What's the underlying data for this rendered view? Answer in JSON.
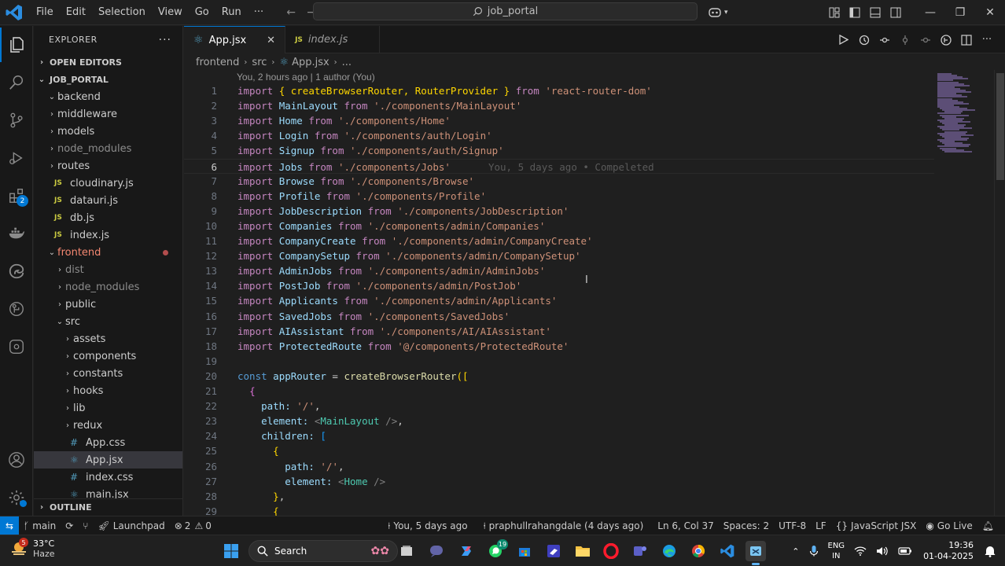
{
  "titlebar": {
    "menu": [
      "File",
      "Edit",
      "Selection",
      "View",
      "Go",
      "Run"
    ],
    "more": "···",
    "search_text": "job_portal"
  },
  "sidebar": {
    "title": "EXPLORER",
    "more": "···",
    "open_editors": "OPEN EDITORS",
    "root": "JOB_PORTAL",
    "backend": "backend",
    "backend_items": [
      {
        "label": "middleware",
        "kind": "folder"
      },
      {
        "label": "models",
        "kind": "folder"
      },
      {
        "label": "node_modules",
        "kind": "folder-dim"
      },
      {
        "label": "routes",
        "kind": "folder"
      },
      {
        "label": "cloudinary.js",
        "kind": "js"
      },
      {
        "label": "datauri.js",
        "kind": "js"
      },
      {
        "label": "db.js",
        "kind": "js"
      },
      {
        "label": "index.js",
        "kind": "js"
      }
    ],
    "frontend": "frontend",
    "frontend_items": [
      {
        "label": "dist",
        "kind": "folder-dim"
      },
      {
        "label": "node_modules",
        "kind": "folder-dim"
      },
      {
        "label": "public",
        "kind": "folder"
      }
    ],
    "src": "src",
    "src_items": [
      {
        "label": "assets",
        "kind": "folder"
      },
      {
        "label": "components",
        "kind": "folder"
      },
      {
        "label": "constants",
        "kind": "folder"
      },
      {
        "label": "hooks",
        "kind": "folder"
      },
      {
        "label": "lib",
        "kind": "folder"
      },
      {
        "label": "redux",
        "kind": "folder"
      },
      {
        "label": "App.css",
        "kind": "css"
      },
      {
        "label": "App.jsx",
        "kind": "jsx"
      },
      {
        "label": "index.css",
        "kind": "css"
      },
      {
        "label": "main.jsx",
        "kind": "jsx"
      }
    ],
    "outline": "OUTLINE",
    "activity_badge": "2"
  },
  "tabs": [
    {
      "label": "App.jsx",
      "active": true,
      "close": "✕"
    },
    {
      "label": "index.js",
      "active": false
    }
  ],
  "breadcrumb": [
    "frontend",
    "src",
    "App.jsx",
    "..."
  ],
  "editor": {
    "codelens": "You, 2 hours ago | 1 author (You)",
    "blame": "You, 5 days ago • Compeleted",
    "imports": [
      {
        "n": "1",
        "name": "{ createBrowserRouter, RouterProvider }",
        "path": "'react-router-dom'"
      },
      {
        "n": "2",
        "name": "MainLayout",
        "path": "'./components/MainLayout'"
      },
      {
        "n": "3",
        "name": "Home",
        "path": "'./components/Home'"
      },
      {
        "n": "4",
        "name": "Login",
        "path": "'./components/auth/Login'"
      },
      {
        "n": "5",
        "name": "Signup",
        "path": "'./components/auth/Signup'"
      },
      {
        "n": "6",
        "name": "Jobs",
        "path": "'./components/Jobs'"
      },
      {
        "n": "7",
        "name": "Browse",
        "path": "'./components/Browse'"
      },
      {
        "n": "8",
        "name": "Profile",
        "path": "'./components/Profile'"
      },
      {
        "n": "9",
        "name": "JobDescription",
        "path": "'./components/JobDescription'"
      },
      {
        "n": "10",
        "name": "Companies",
        "path": "'./components/admin/Companies'"
      },
      {
        "n": "11",
        "name": "CompanyCreate",
        "path": "'./components/admin/CompanyCreate'"
      },
      {
        "n": "12",
        "name": "CompanySetup",
        "path": "'./components/admin/CompanySetup'"
      },
      {
        "n": "13",
        "name": "AdminJobs",
        "path": "'./components/admin/AdminJobs'"
      },
      {
        "n": "14",
        "name": "PostJob",
        "path": "'./components/admin/PostJob'"
      },
      {
        "n": "15",
        "name": "Applicants",
        "path": "'./components/admin/Applicants'"
      },
      {
        "n": "16",
        "name": "SavedJobs",
        "path": "'./components/SavedJobs'"
      },
      {
        "n": "17",
        "name": "AIAssistant",
        "path": "'./components/AI/AIAssistant'"
      },
      {
        "n": "18",
        "name": "ProtectedRoute",
        "path": "'@/components/ProtectedRoute'"
      }
    ],
    "import_kw": "import",
    "from_kw": "from",
    "rest_numbers": [
      "19",
      "20",
      "21",
      "22",
      "23",
      "24",
      "25",
      "26",
      "27",
      "28",
      "29"
    ],
    "l20": {
      "kw": "const",
      "id": "appRouter",
      "eq": " = ",
      "fn": "createBrowserRouter",
      "open": "(["
    },
    "l21": "{",
    "l22": {
      "key": "path:",
      "val": "'/'",
      "end": ","
    },
    "l23": {
      "key": "element:",
      "tag_open": "<",
      "tag": "MainLayout",
      "tag_close": " />",
      "end": ","
    },
    "l24": {
      "key": "children:",
      "open": "["
    },
    "l25": "{",
    "l26": {
      "key": "path:",
      "val": "'/'",
      "end": ","
    },
    "l27": {
      "key": "element:",
      "tag_open": "<",
      "tag": "Home",
      "tag_close": " />"
    },
    "l28": {
      "close": "}",
      "end": ","
    },
    "l29": "{"
  },
  "statusbar": {
    "branch": "main",
    "launchpad": "Launchpad",
    "errors": "2",
    "warnings": "0",
    "blame": "You, 5 days ago",
    "author": "praphullrahangdale (4 days ago)",
    "position": "Ln 6, Col 37",
    "spaces": "Spaces: 2",
    "encoding": "UTF-8",
    "eol": "LF",
    "language": "JavaScript JSX",
    "golive": "Go Live"
  },
  "taskbar": {
    "temp": "33°C",
    "weather": "Haze",
    "weather_badge": "5",
    "search": "Search",
    "whatsapp_badge": "19",
    "lang1": "ENG",
    "lang2": "IN",
    "time": "19:36",
    "date": "01-04-2025"
  }
}
